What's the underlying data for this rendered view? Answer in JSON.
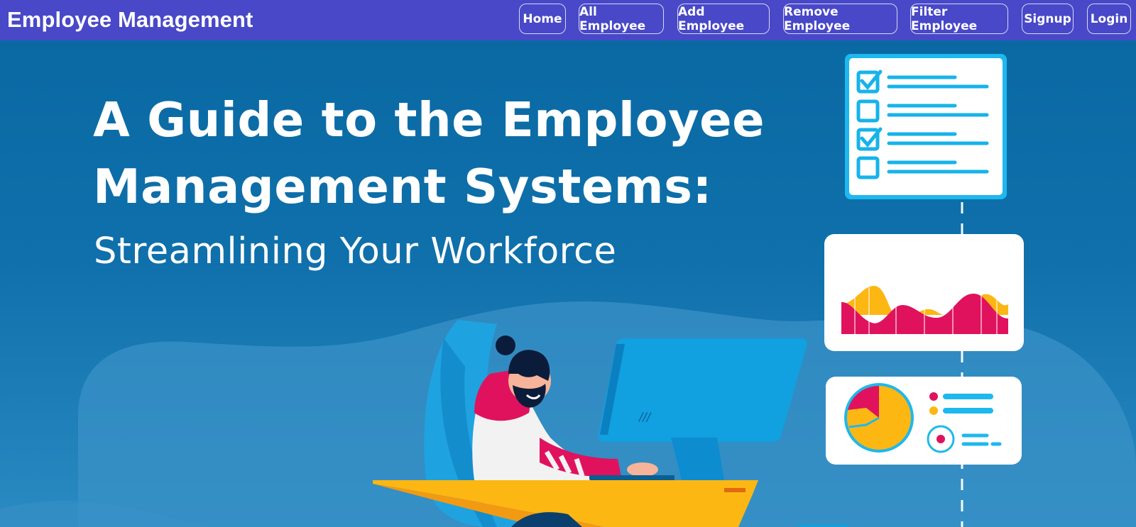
{
  "brand": "Employee Management",
  "nav": [
    {
      "label": "Home"
    },
    {
      "label": "All Employee"
    },
    {
      "label": "Add Employee"
    },
    {
      "label": "Remove Employee"
    },
    {
      "label": "Filter Employee"
    },
    {
      "label": "Signup"
    },
    {
      "label": "Login"
    }
  ],
  "hero": {
    "title_line1": "A Guide to the Employee",
    "title_line2": "Management Systems:",
    "subtitle": "Streamlining Your Workforce"
  },
  "illustration": {
    "checklist_icon": "checklist-card-icon",
    "area_chart_icon": "area-chart-card-icon",
    "pie_chart_icon": "pie-chart-card-icon",
    "person_icon": "person-at-computer-illustration"
  },
  "colors": {
    "navbar": "#4848c8",
    "hero_bg": "#0a69a3",
    "accent_blue": "#00b4e8",
    "accent_pink": "#e0125e",
    "accent_yellow": "#fdb713"
  }
}
